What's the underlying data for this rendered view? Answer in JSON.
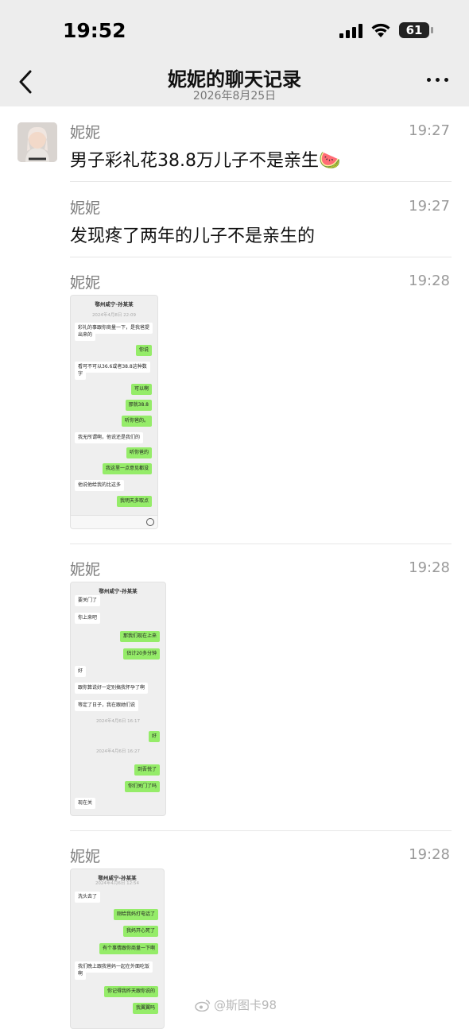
{
  "status_bar": {
    "time": "19:52",
    "battery": "61"
  },
  "header": {
    "title": "妮妮的聊天记录",
    "date": "2026年8月25日"
  },
  "messages": [
    {
      "sender": "妮妮",
      "time": "19:27",
      "text": "男子彩礼花38.8万儿子不是亲生🍉"
    },
    {
      "sender": "妮妮",
      "time": "19:27",
      "text": "发现疼了两年的儿子不是亲生的"
    },
    {
      "sender": "妮妮",
      "time": "19:28",
      "screenshot": {
        "title": "鄂州咸宁-孙某某",
        "stamp": "2024年4月8日 22:09",
        "rows": [
          {
            "dir": "in",
            "text": "彩礼的事跟你商量一下，是我爸提"
          },
          {
            "dir": "in",
            "text": "出来的"
          },
          {
            "dir": "out",
            "text": "你说"
          },
          {
            "dir": "in",
            "text": "看可不可以36.6或者38.8这种数"
          },
          {
            "dir": "in",
            "text": "字"
          },
          {
            "dir": "out",
            "text": "可以啊"
          },
          {
            "dir": "out",
            "text": "那就38.8"
          },
          {
            "dir": "out",
            "text": "听你爸的。"
          },
          {
            "dir": "in",
            "text": "我无所谓啊，他说还是我们的"
          },
          {
            "dir": "out",
            "text": "听你爸的"
          },
          {
            "dir": "out",
            "text": "我这里一点意见都没"
          },
          {
            "dir": "in",
            "text": "他说他给我的比这多"
          },
          {
            "dir": "out",
            "text": "我明天多取点"
          }
        ]
      }
    },
    {
      "sender": "妮妮",
      "time": "19:28",
      "screenshot": {
        "title": "鄂州咸宁-孙某某",
        "rows": [
          {
            "dir": "in",
            "text": "要关门了"
          },
          {
            "dir": "in",
            "text": "你上来吧"
          },
          {
            "dir": "out",
            "text": "那我们现在上来"
          },
          {
            "dir": "out",
            "text": "估计20多分钟"
          },
          {
            "dir": "in",
            "text": "好"
          },
          {
            "dir": "in",
            "text": "跟你算说好一定别搞我怀孕了啊"
          },
          {
            "dir": "in",
            "text": "等定了日子，我在跟她们说"
          },
          {
            "dir": "stamp",
            "text": "2024年4月6日 16:17"
          },
          {
            "dir": "out",
            "text": "好"
          },
          {
            "dir": "stamp",
            "text": "2024年4月6日 16:27"
          },
          {
            "dir": "out",
            "text": "到吾悦了"
          },
          {
            "dir": "out",
            "text": "你们关门了吗"
          },
          {
            "dir": "in",
            "text": "现在关"
          }
        ]
      }
    },
    {
      "sender": "妮妮",
      "time": "19:28",
      "screenshot": {
        "title": "鄂州咸宁-孙某某",
        "stamp": "2024年4月6日 12:54",
        "rows": [
          {
            "dir": "in",
            "text": "洗头去了"
          },
          {
            "dir": "out",
            "text": "刚给我妈打电话了"
          },
          {
            "dir": "out",
            "text": "我妈开心死了"
          },
          {
            "dir": "out",
            "text": "有个事情跟你商量一下啊"
          },
          {
            "dir": "in",
            "text": "我们晚上跟我爸妈一起在外面吃饭"
          },
          {
            "dir": "in",
            "text": "啊"
          },
          {
            "dir": "out",
            "text": "你记得我昨天跟你说的"
          },
          {
            "dir": "out",
            "text": "我翼翼吗"
          }
        ]
      }
    }
  ],
  "watermark": "@斯图卡98"
}
